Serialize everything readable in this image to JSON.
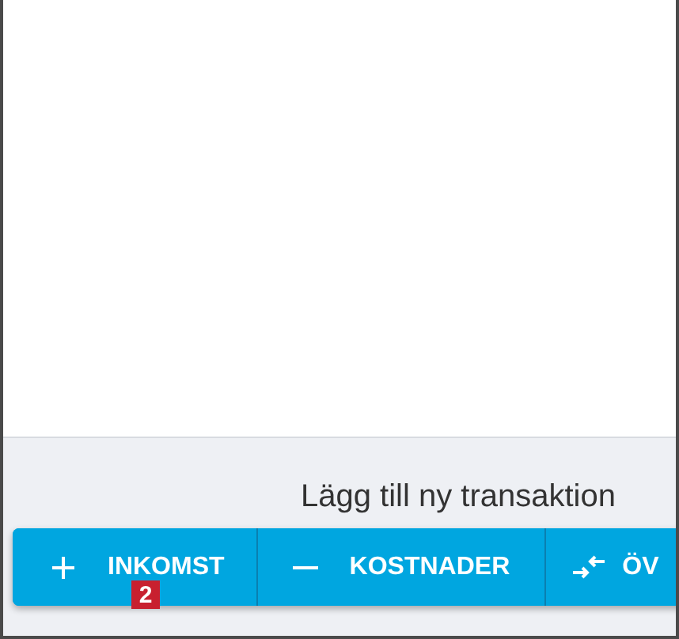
{
  "add_transaction": {
    "title": "Lägg till ny transaktion",
    "buttons": [
      {
        "kind": "income",
        "label": "INKOMST"
      },
      {
        "kind": "expense",
        "label": "KOSTNADER"
      },
      {
        "kind": "transfer",
        "label": "ÖV"
      }
    ]
  },
  "callout": {
    "label": "2"
  }
}
